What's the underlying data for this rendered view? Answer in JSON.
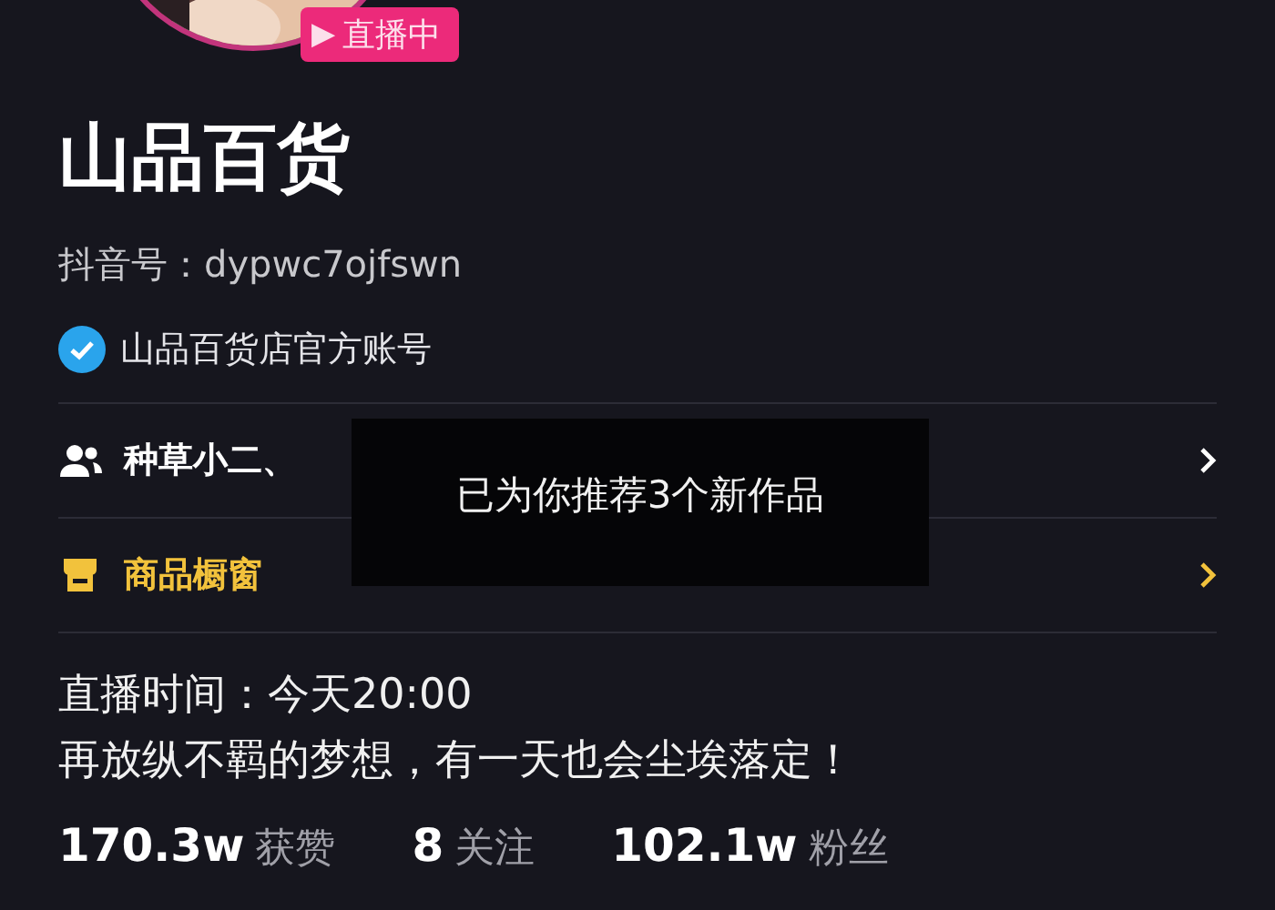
{
  "live_badge": {
    "icon": "▶",
    "label": "直播中"
  },
  "profile": {
    "name": "山品百货",
    "douyin_id": "抖音号：dypwc7ojfswn",
    "verified": true,
    "verified_label": "山品百货店官方账号"
  },
  "rows": [
    {
      "kind": "followers",
      "text": "种草小二、"
    },
    {
      "kind": "shop",
      "text": "商品橱窗"
    }
  ],
  "toast": "已为你推荐3个新作品",
  "bio": [
    "直播时间：今天20:00",
    "再放纵不羁的梦想，有一天也会尘埃落定！"
  ],
  "stats": [
    {
      "value": "170.3w",
      "label": "获赞"
    },
    {
      "value": "8",
      "label": "关注"
    },
    {
      "value": "102.1w",
      "label": "粉丝"
    }
  ]
}
